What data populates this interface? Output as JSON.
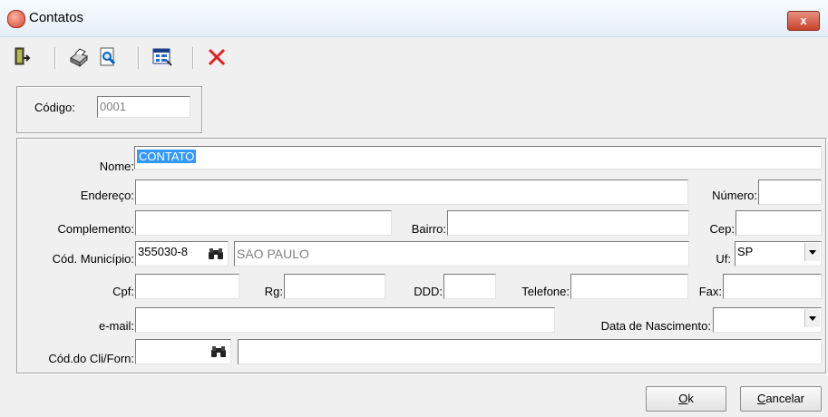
{
  "window": {
    "title": "Contatos",
    "close_label": "x"
  },
  "toolbar": {
    "items": [
      "exit-icon",
      "printer-icon",
      "preview-icon",
      "form-icon",
      "delete-icon"
    ]
  },
  "header": {
    "codigo_label": "Código:",
    "codigo_value": "0001"
  },
  "form": {
    "nome_label": "Nome:",
    "nome_value": "CONTATO",
    "endereco_label": "Endereço:",
    "endereco_value": "",
    "numero_label": "Número:",
    "numero_value": "",
    "complemento_label": "Complemento:",
    "complemento_value": "",
    "bairro_label": "Bairro:",
    "bairro_value": "",
    "cep_label": "Cep:",
    "cep_value": "",
    "cod_municipio_label": "Cód. Município:",
    "cod_municipio_value": "355030-8",
    "municipio_name": "SAO PAULO",
    "uf_label": "Uf:",
    "uf_value": "SP",
    "cpf_label": "Cpf:",
    "cpf_value": "",
    "rg_label": "Rg:",
    "rg_value": "",
    "ddd_label": "DDD:",
    "ddd_value": "",
    "telefone_label": "Telefone:",
    "telefone_value": "",
    "fax_label": "Fax:",
    "fax_value": "",
    "email_label": "e-mail:",
    "email_value": "",
    "data_nasc_label": "Data de Nascimento:",
    "data_nasc_value": "",
    "cod_cli_label": "Cód.do Cli/Forn:",
    "cod_cli_value": "",
    "cli_name_value": ""
  },
  "buttons": {
    "ok_label": "Ok",
    "cancel_label": "Cancelar"
  },
  "colors": {
    "selection": "#3399ff",
    "delete": "#e02020"
  }
}
